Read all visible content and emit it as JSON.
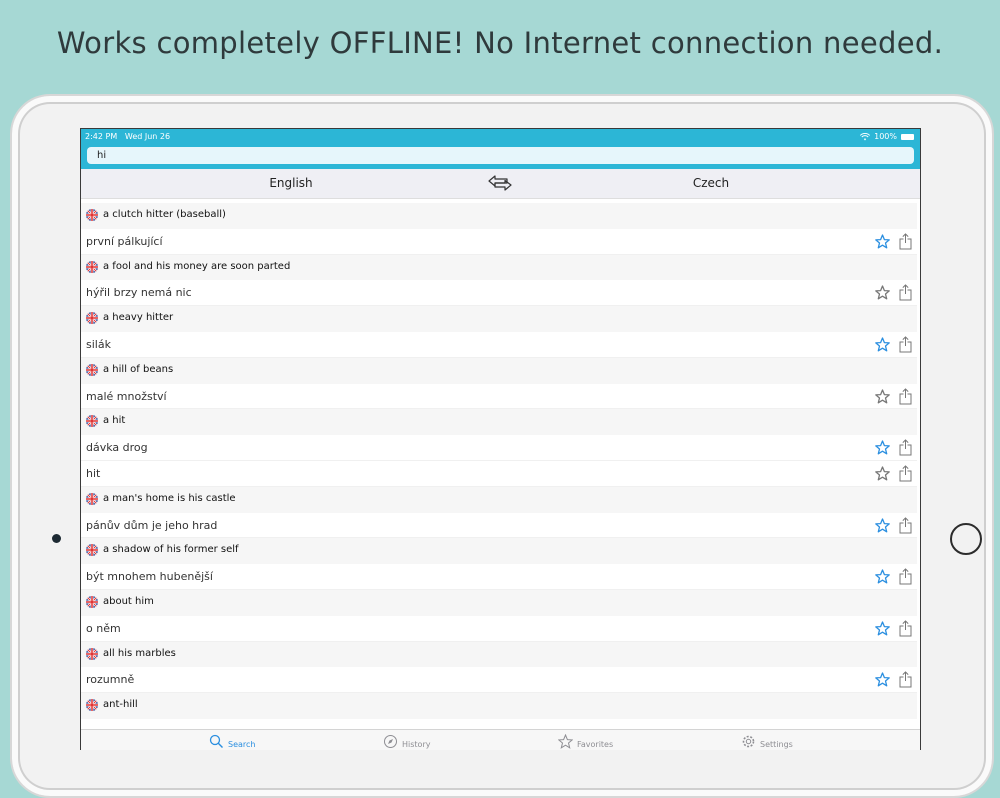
{
  "headline": "Works completely OFFLINE! No Internet connection needed.",
  "status": {
    "time": "2:42 PM",
    "date": "Wed Jun 26",
    "battery": "100%"
  },
  "search": {
    "query": "hi"
  },
  "languages": {
    "source": "English",
    "target": "Czech"
  },
  "entries": [
    {
      "source": "a clutch hitter (baseball)",
      "translations": [
        {
          "text": "první pálkující",
          "favorite_active": true
        }
      ]
    },
    {
      "source": "a fool and his money are soon parted",
      "translations": [
        {
          "text": "hýřil brzy nemá nic",
          "favorite_active": false
        }
      ]
    },
    {
      "source": "a heavy hitter",
      "translations": [
        {
          "text": "silák",
          "favorite_active": true
        }
      ]
    },
    {
      "source": "a hill of beans",
      "translations": [
        {
          "text": "malé množství",
          "favorite_active": false
        }
      ]
    },
    {
      "source": "a hit",
      "translations": [
        {
          "text": "dávka drog",
          "favorite_active": true
        },
        {
          "text": "hit",
          "favorite_active": false
        }
      ]
    },
    {
      "source": "a man's home is his castle",
      "translations": [
        {
          "text": "pánův dům je jeho hrad",
          "favorite_active": true
        }
      ]
    },
    {
      "source": "a shadow of his former self",
      "translations": [
        {
          "text": "být mnohem hubenější",
          "favorite_active": true
        }
      ]
    },
    {
      "source": "about him",
      "translations": [
        {
          "text": "o něm",
          "favorite_active": true
        }
      ]
    },
    {
      "source": "all his marbles",
      "translations": [
        {
          "text": "rozumně",
          "favorite_active": true
        }
      ]
    },
    {
      "source": "ant-hill",
      "translations": []
    }
  ],
  "tabs": [
    {
      "label": "Search",
      "icon": "search-icon",
      "active": true
    },
    {
      "label": "History",
      "icon": "compass-icon",
      "active": false
    },
    {
      "label": "Favorites",
      "icon": "star-icon",
      "active": false
    },
    {
      "label": "Settings",
      "icon": "gear-icon",
      "active": false
    }
  ],
  "colors": {
    "accent": "#2cb6d6",
    "star_active": "#2b8fe0",
    "star_inactive": "#777777",
    "background": "#a6d8d4"
  }
}
